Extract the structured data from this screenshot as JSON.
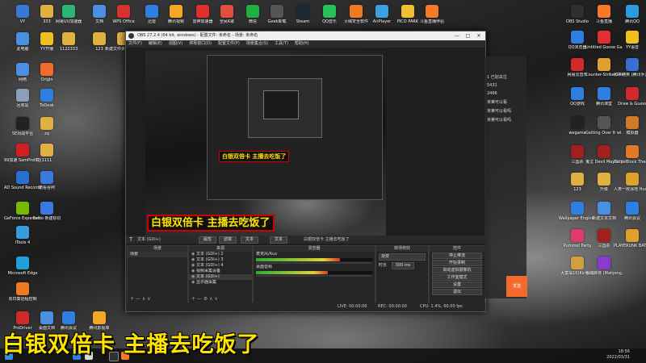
{
  "desktop_icons": [
    {
      "label": "VY",
      "color": "#3a78d8"
    },
    {
      "label": "333",
      "color": "#e0b040"
    },
    {
      "label": "网易UU加速器",
      "color": "#2bb673"
    },
    {
      "label": "文档",
      "color": "#4a90e2"
    },
    {
      "label": "WPS Office",
      "color": "#d9322e"
    },
    {
      "label": "迅雷",
      "color": "#2e7fe0"
    },
    {
      "label": "腾讯视频",
      "color": "#f5a623"
    },
    {
      "label": "雷神加速器",
      "color": "#e02f2f"
    },
    {
      "label": "全民K歌",
      "color": "#e0503c"
    },
    {
      "label": "微信",
      "color": "#20b040"
    },
    {
      "label": "Geek卸载",
      "color": "#555555"
    },
    {
      "label": "Steam",
      "color": "#1b2838"
    },
    {
      "label": "QQ音乐",
      "color": "#28c05a"
    },
    {
      "label": "火绒安全软件",
      "color": "#f07a22"
    },
    {
      "label": "AirPlayer",
      "color": "#3aa0e0"
    },
    {
      "label": "PICO PARK",
      "color": "#f0c030"
    },
    {
      "label": "斗鱼直播伴侣",
      "color": "#f57a2a"
    },
    {
      "label": "此电脑",
      "color": "#4a90e2"
    },
    {
      "label": "YY开播",
      "color": "#f0c020"
    },
    {
      "label": "1122333",
      "color": "#e0b040"
    },
    {
      "label": "123",
      "color": "#e0b040"
    },
    {
      "label": "新建文件夹 2021120...",
      "color": "#e0b040"
    },
    {
      "label": "网络",
      "color": "#4a90e2"
    },
    {
      "label": "Origin",
      "color": "#f26b2d"
    },
    {
      "label": "回收站",
      "color": "#8aa0b8"
    },
    {
      "label": "ToDesk",
      "color": "#2e7fe0"
    },
    {
      "label": "5E对战平台",
      "color": "#222222"
    },
    {
      "label": "zq",
      "color": "#e0b040"
    },
    {
      "label": "99加速 SamProt截图",
      "color": "#d02020"
    },
    {
      "label": "1111",
      "color": "#e0b040"
    },
    {
      "label": "AD Sound Recorder",
      "color": "#2a6fd0"
    },
    {
      "label": "酷看谷阿",
      "color": "#3a7ae0"
    },
    {
      "label": "GeForce Experience",
      "color": "#76b900"
    },
    {
      "label": "Evillo 新建标识",
      "color": "#3a7ae0"
    },
    {
      "label": "iTools 4",
      "color": "#3a9ae0"
    },
    {
      "label": "Microsoft Edge",
      "color": "#1fa0d8"
    },
    {
      "label": "向日葵远程控制",
      "color": "#f07a22"
    },
    {
      "label": "ProDriver",
      "color": "#d02a2a"
    },
    {
      "label": "桌面文档",
      "color": "#4a90e2"
    },
    {
      "label": "腾讯会议",
      "color": "#2e7fe0"
    },
    {
      "label": "腾讯影视库",
      "color": "#f5a623"
    },
    {
      "label": "OBS Studio",
      "color": "#303030"
    },
    {
      "label": "斗鱼直播",
      "color": "#f57a2a"
    },
    {
      "label": "腾讯QQ",
      "color": "#2e9ae0"
    },
    {
      "label": "QQ浏览器",
      "color": "#2e7fe0"
    },
    {
      "label": "Untitled Goose Game",
      "color": "#e03030"
    },
    {
      "label": "YY语音",
      "color": "#f0c020"
    },
    {
      "label": "网易云音乐",
      "color": "#d02a2a"
    },
    {
      "label": "Counter-Strike Global Off...",
      "color": "#e0a030"
    },
    {
      "label": "和平精英 (腾讯手游助手)",
      "color": "#3a6fd0"
    },
    {
      "label": "QQ游戏",
      "color": "#2e7fe0"
    },
    {
      "label": "腾讯课堂",
      "color": "#2e7fe0"
    },
    {
      "label": "Draw & Guess",
      "color": "#d02a2a"
    },
    {
      "label": "wegame",
      "color": "#222222"
    },
    {
      "label": "Getting Over It wi...",
      "color": "#555555"
    },
    {
      "label": "模拟器",
      "color": "#d07a2a"
    },
    {
      "label": "三国杀",
      "color": "#a02020"
    },
    {
      "label": "鬼泣 Devil May Cry",
      "color": "#a02020"
    },
    {
      "label": "BattleBlock Theater",
      "color": "#e07a2a"
    },
    {
      "label": "123",
      "color": "#e0b040"
    },
    {
      "label": "升级",
      "color": "#e0b040"
    },
    {
      "label": "人类一败涂地 Human Fal...",
      "color": "#e0a030"
    },
    {
      "label": "Wallpaper Engine: ...",
      "color": "#2e7fe0"
    },
    {
      "label": "新建文本文档",
      "color": "#4a90e2"
    },
    {
      "label": "腾讯会议",
      "color": "#2e7fe0"
    },
    {
      "label": "Pummel Party",
      "color": "#e03a6a"
    },
    {
      "label": "三国杀",
      "color": "#a02020"
    },
    {
      "label": "PLAYERUNK BATTLEGR...",
      "color": "#e0a030"
    },
    {
      "label": "大富翁10(Kiche...",
      "color": "#d0a040"
    },
    {
      "label": "雀魂麻将 (Mahjong...",
      "color": "#8a3ad0"
    }
  ],
  "obs": {
    "title": "OBS 27.2.4 (64 bit, windows) - 配置文件: 未命名 - 场景: 未命名",
    "menu": [
      "文件(F)",
      "编辑(E)",
      "视图(V)",
      "停靠窗口(D)",
      "配置文件(P)",
      "场景集合(S)",
      "工具(T)",
      "帮助(H)"
    ],
    "source_label": "文本 (GDI+)",
    "toolbar": {
      "properties": "属性",
      "filters": "滤镜",
      "text_label": "文本",
      "text_value": "白银双倍卡 主播去吃饭了"
    },
    "preview_caption": "白银双倍卡 主播去吃饭了",
    "nested_caption": "白银双倍卡 主播去吃饭了",
    "docks": {
      "scenes": {
        "title": "场景",
        "items": [
          "场景"
        ]
      },
      "sources": {
        "title": "来源",
        "items": [
          "文本 (GDI+) 2",
          "文本 (GDI+) 3",
          "文本 (GDI+) 4",
          "视频采集设备",
          "文本 (GDI+)",
          "显示器采集"
        ]
      },
      "mixer": {
        "title": "混音器",
        "channels": [
          {
            "name": "麦克风/Aux",
            "level": 0.72
          },
          {
            "name": "桌面音频",
            "level": 0.62
          }
        ]
      },
      "transitions": {
        "title": "转场特效",
        "type": "渐变",
        "duration_label": "时长",
        "duration": "300 ms"
      },
      "controls": {
        "title": "控件",
        "buttons": [
          "停止推流",
          "开始录制",
          "启动虚拟摄像机",
          "工作室模式",
          "设置",
          "退出"
        ]
      }
    },
    "status": {
      "live": "LIVE: 00:00:00",
      "rec": "REC: 00:00:00",
      "cpu": "CPU: 1.4%, 60.00 fps"
    }
  },
  "chat": {
    "lines": [
      "1 已加关注",
      "5431",
      "2466",
      "米莱可以看",
      "米莱可以看吗",
      "米莱可以看吗"
    ],
    "send": "发送"
  },
  "clock": {
    "time": "18:56",
    "date": "2022/03/31"
  },
  "big_caption": "白银双倍卡 主播去吃饭了"
}
